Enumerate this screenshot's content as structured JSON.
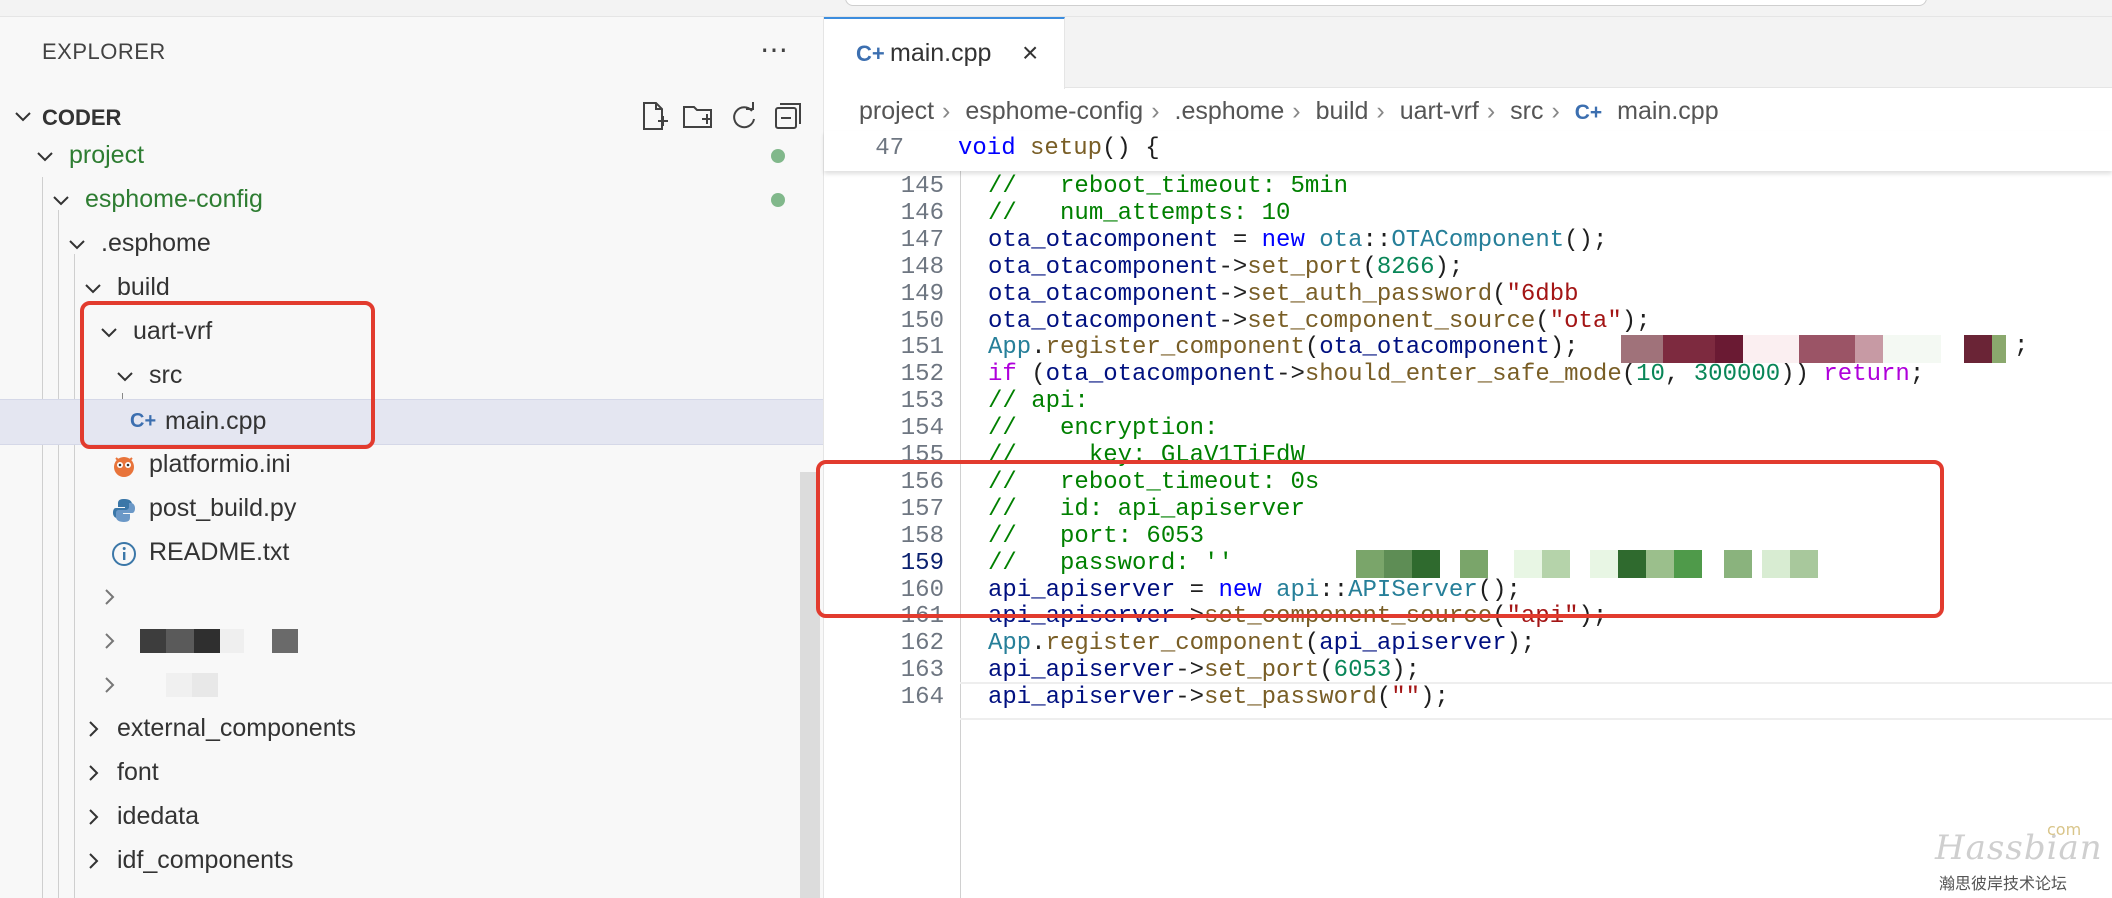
{
  "explorer": {
    "title": "EXPLORER",
    "more_icon": "ellipsis-icon",
    "section_title": "CODER",
    "actions": [
      "new-file-icon",
      "new-folder-icon",
      "refresh-icon",
      "collapse-all-icon"
    ]
  },
  "tree": {
    "project": "project",
    "esphome_config": "esphome-config",
    "esphome_dir": ".esphome",
    "build": "build",
    "uart_vrf": "uart-vrf",
    "src": "src",
    "main_cpp": "main.cpp",
    "platformio": "platformio.ini",
    "post_build": "post_build.py",
    "readme": "README.txt",
    "external_components": "external_components",
    "font": "font",
    "idedata": "idedata",
    "idf_components": "idf_components"
  },
  "tab": {
    "label": "main.cpp",
    "icon": "cpp-file-icon",
    "close": "×"
  },
  "breadcrumb": [
    "project",
    "esphome-config",
    ".esphome",
    "build",
    "uart-vrf",
    "src",
    "main.cpp"
  ],
  "sticky": {
    "line": "47",
    "text": "void setup() {"
  },
  "code_lines": [
    {
      "n": "145",
      "t": "//   reboot_timeout: 5min"
    },
    {
      "n": "146",
      "t": "//   num_attempts: 10"
    },
    {
      "n": "147",
      "t": "ota_otacomponent = new ota::OTAComponent();"
    },
    {
      "n": "148",
      "t": "ota_otacomponent->set_port(8266);"
    },
    {
      "n": "149",
      "t": "ota_otacomponent->set_auth_password(\"6dbb"
    },
    {
      "n": "150",
      "t": "ota_otacomponent->set_component_source(\"ota\");"
    },
    {
      "n": "151",
      "t": "App.register_component(ota_otacomponent);"
    },
    {
      "n": "152",
      "t": "if (ota_otacomponent->should_enter_safe_mode(10, 300000)) return;"
    },
    {
      "n": "153",
      "t": "// api:"
    },
    {
      "n": "154",
      "t": "//   encryption:"
    },
    {
      "n": "155",
      "t": "//     key: GLaV1TiFdW"
    },
    {
      "n": "156",
      "t": "//   reboot_timeout: 0s"
    },
    {
      "n": "157",
      "t": "//   id: api_apiserver"
    },
    {
      "n": "158",
      "t": "//   port: 6053"
    },
    {
      "n": "159",
      "t": "//   password: ''"
    },
    {
      "n": "160",
      "t": "api_apiserver = new api::APIServer();"
    },
    {
      "n": "161",
      "t": "api_apiserver->set_component_source(\"api\");"
    },
    {
      "n": "162",
      "t": "App.register_component(api_apiserver);"
    },
    {
      "n": "163",
      "t": "api_apiserver->set_port(6053);"
    },
    {
      "n": "164",
      "t": "api_apiserver->set_password(\"\");"
    }
  ],
  "watermark": {
    "main": "Hassbian",
    "com": "com",
    "sub": "瀚思彼岸技术论坛"
  },
  "colors": {
    "annotation": "#e23b2e",
    "git_modified": "#81b88b",
    "accent": "#3c8dde"
  }
}
